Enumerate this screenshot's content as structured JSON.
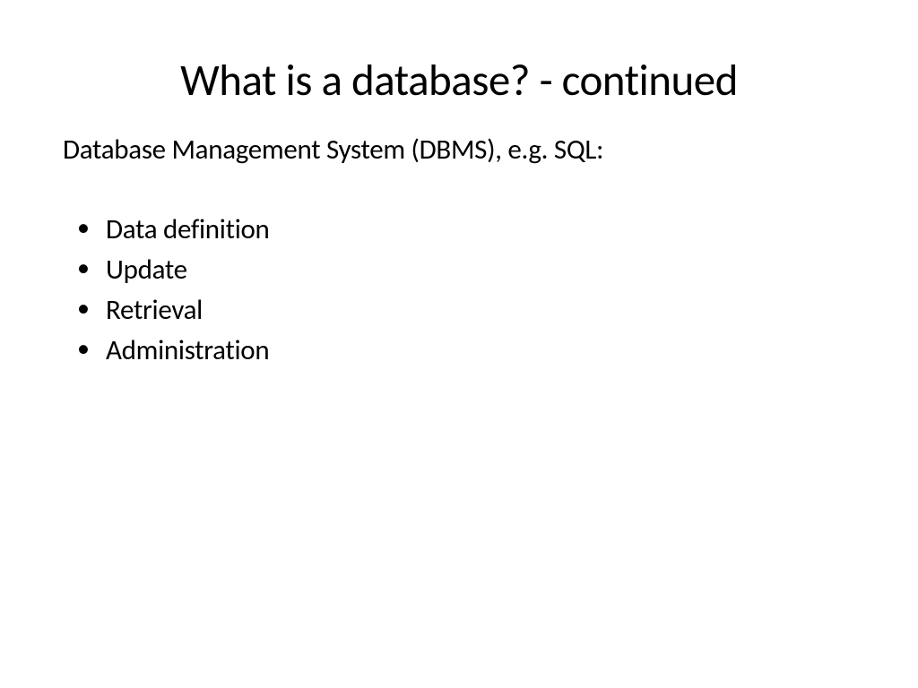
{
  "slide": {
    "title": "What is a database? - continued",
    "subtitle": "Database Management System (DBMS), e.g. SQL:",
    "bullets": [
      "Data definition",
      "Update",
      "Retrieval",
      "Administration"
    ]
  }
}
